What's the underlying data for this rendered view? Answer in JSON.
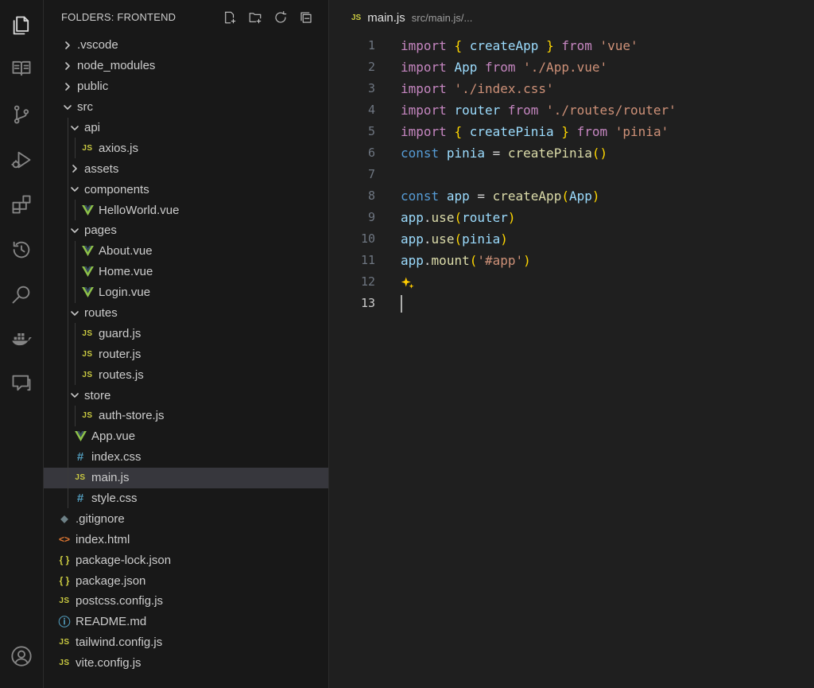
{
  "sidebar": {
    "header": "FOLDERS: FRONTEND",
    "tools": [
      "new-file-icon",
      "new-folder-icon",
      "refresh-icon",
      "collapse-all-icon"
    ],
    "tree": [
      {
        "label": ".vscode",
        "depth": 0,
        "type": "folder",
        "open": false
      },
      {
        "label": "node_modules",
        "depth": 0,
        "type": "folder",
        "open": false
      },
      {
        "label": "public",
        "depth": 0,
        "type": "folder",
        "open": false
      },
      {
        "label": "src",
        "depth": 0,
        "type": "folder",
        "open": true
      },
      {
        "label": "api",
        "depth": 1,
        "type": "folder",
        "open": true
      },
      {
        "label": "axios.js",
        "depth": 2,
        "type": "js"
      },
      {
        "label": "assets",
        "depth": 1,
        "type": "folder",
        "open": false
      },
      {
        "label": "components",
        "depth": 1,
        "type": "folder",
        "open": true
      },
      {
        "label": "HelloWorld.vue",
        "depth": 2,
        "type": "vue"
      },
      {
        "label": "pages",
        "depth": 1,
        "type": "folder",
        "open": true
      },
      {
        "label": "About.vue",
        "depth": 2,
        "type": "vue"
      },
      {
        "label": "Home.vue",
        "depth": 2,
        "type": "vue"
      },
      {
        "label": "Login.vue",
        "depth": 2,
        "type": "vue"
      },
      {
        "label": "routes",
        "depth": 1,
        "type": "folder",
        "open": true
      },
      {
        "label": "guard.js",
        "depth": 2,
        "type": "js"
      },
      {
        "label": "router.js",
        "depth": 2,
        "type": "js"
      },
      {
        "label": "routes.js",
        "depth": 2,
        "type": "js"
      },
      {
        "label": "store",
        "depth": 1,
        "type": "folder",
        "open": true
      },
      {
        "label": "auth-store.js",
        "depth": 2,
        "type": "js"
      },
      {
        "label": "App.vue",
        "depth": 1,
        "type": "vue"
      },
      {
        "label": "index.css",
        "depth": 1,
        "type": "css"
      },
      {
        "label": "main.js",
        "depth": 1,
        "type": "js",
        "selected": true
      },
      {
        "label": "style.css",
        "depth": 1,
        "type": "css"
      },
      {
        "label": ".gitignore",
        "depth": 0,
        "type": "git"
      },
      {
        "label": "index.html",
        "depth": 0,
        "type": "html"
      },
      {
        "label": "package-lock.json",
        "depth": 0,
        "type": "json"
      },
      {
        "label": "package.json",
        "depth": 0,
        "type": "json"
      },
      {
        "label": "postcss.config.js",
        "depth": 0,
        "type": "js"
      },
      {
        "label": "README.md",
        "depth": 0,
        "type": "info"
      },
      {
        "label": "tailwind.config.js",
        "depth": 0,
        "type": "js"
      },
      {
        "label": "vite.config.js",
        "depth": 0,
        "type": "js"
      }
    ]
  },
  "activity_bar": [
    "explorer-icon",
    "book-icon",
    "source-control-icon",
    "run-debug-icon",
    "extensions-icon",
    "timeline-icon",
    "search-icon",
    "docker-icon",
    "chat-icon",
    "account-icon"
  ],
  "editor": {
    "tab": {
      "badge": "JS",
      "title": "main.js",
      "path": "src/main.js/..."
    },
    "current_line": 13,
    "lines": [
      [
        [
          "kw2",
          "import"
        ],
        [
          "pl",
          " "
        ],
        [
          "br",
          "{"
        ],
        [
          "pl",
          " "
        ],
        [
          "var",
          "createApp"
        ],
        [
          "pl",
          " "
        ],
        [
          "br",
          "}"
        ],
        [
          "pl",
          " "
        ],
        [
          "kw2",
          "from"
        ],
        [
          "pl",
          " "
        ],
        [
          "str",
          "'vue'"
        ]
      ],
      [
        [
          "kw2",
          "import"
        ],
        [
          "pl",
          " "
        ],
        [
          "var",
          "App"
        ],
        [
          "pl",
          " "
        ],
        [
          "kw2",
          "from"
        ],
        [
          "pl",
          " "
        ],
        [
          "str",
          "'./App.vue'"
        ]
      ],
      [
        [
          "kw2",
          "import"
        ],
        [
          "pl",
          " "
        ],
        [
          "str",
          "'./index.css'"
        ]
      ],
      [
        [
          "kw2",
          "import"
        ],
        [
          "pl",
          " "
        ],
        [
          "var",
          "router"
        ],
        [
          "pl",
          " "
        ],
        [
          "kw2",
          "from"
        ],
        [
          "pl",
          " "
        ],
        [
          "str",
          "'./routes/router'"
        ]
      ],
      [
        [
          "kw2",
          "import"
        ],
        [
          "pl",
          " "
        ],
        [
          "br",
          "{"
        ],
        [
          "pl",
          " "
        ],
        [
          "var",
          "createPinia"
        ],
        [
          "pl",
          " "
        ],
        [
          "br",
          "}"
        ],
        [
          "pl",
          " "
        ],
        [
          "kw2",
          "from"
        ],
        [
          "pl",
          " "
        ],
        [
          "str",
          "'pinia'"
        ]
      ],
      [
        [
          "kw",
          "const"
        ],
        [
          "pl",
          " "
        ],
        [
          "var",
          "pinia"
        ],
        [
          "pl",
          " = "
        ],
        [
          "fn",
          "createPinia"
        ],
        [
          "br",
          "()"
        ]
      ],
      [],
      [
        [
          "kw",
          "const"
        ],
        [
          "pl",
          " "
        ],
        [
          "var",
          "app"
        ],
        [
          "pl",
          " = "
        ],
        [
          "fn",
          "createApp"
        ],
        [
          "br",
          "("
        ],
        [
          "var",
          "App"
        ],
        [
          "br",
          ")"
        ]
      ],
      [
        [
          "var",
          "app"
        ],
        [
          "pl",
          "."
        ],
        [
          "fn",
          "use"
        ],
        [
          "br",
          "("
        ],
        [
          "var",
          "router"
        ],
        [
          "br",
          ")"
        ]
      ],
      [
        [
          "var",
          "app"
        ],
        [
          "pl",
          "."
        ],
        [
          "fn",
          "use"
        ],
        [
          "br",
          "("
        ],
        [
          "var",
          "pinia"
        ],
        [
          "br",
          ")"
        ]
      ],
      [
        [
          "var",
          "app"
        ],
        [
          "pl",
          "."
        ],
        [
          "fn",
          "mount"
        ],
        [
          "br",
          "("
        ],
        [
          "str",
          "'#app'"
        ],
        [
          "br",
          ")"
        ]
      ],
      [],
      []
    ]
  },
  "colors": {
    "activity_bg": "#181818",
    "sidebar_bg": "#181818",
    "editor_bg": "#1f1f1f",
    "selection_bg": "#37373d",
    "js_icon": "#cbcb41",
    "vue_icon": "#8dc149",
    "css_icon": "#519aba"
  }
}
